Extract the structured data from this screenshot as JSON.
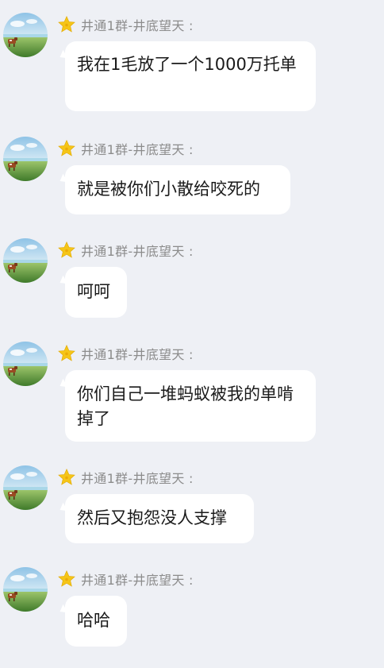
{
  "sender_name": "井通1群-井底望天 :",
  "messages": [
    {
      "text": "我在1毛放了一个1000万托单"
    },
    {
      "text": "就是被你们小散给咬死的"
    },
    {
      "text": "呵呵"
    },
    {
      "text": "你们自己一堆蚂蚁被我的单啃掉了"
    },
    {
      "text": "然后又抱怨没人支撑"
    },
    {
      "text": "哈哈"
    }
  ],
  "colors": {
    "background": "#eef0f5",
    "bubble": "#ffffff",
    "sender_text": "#8c8c8c",
    "message_text": "#1a1a1a",
    "star": "#f5c518"
  },
  "icons": {
    "avatar": "landscape-cow-avatar",
    "badge": "star-icon"
  }
}
